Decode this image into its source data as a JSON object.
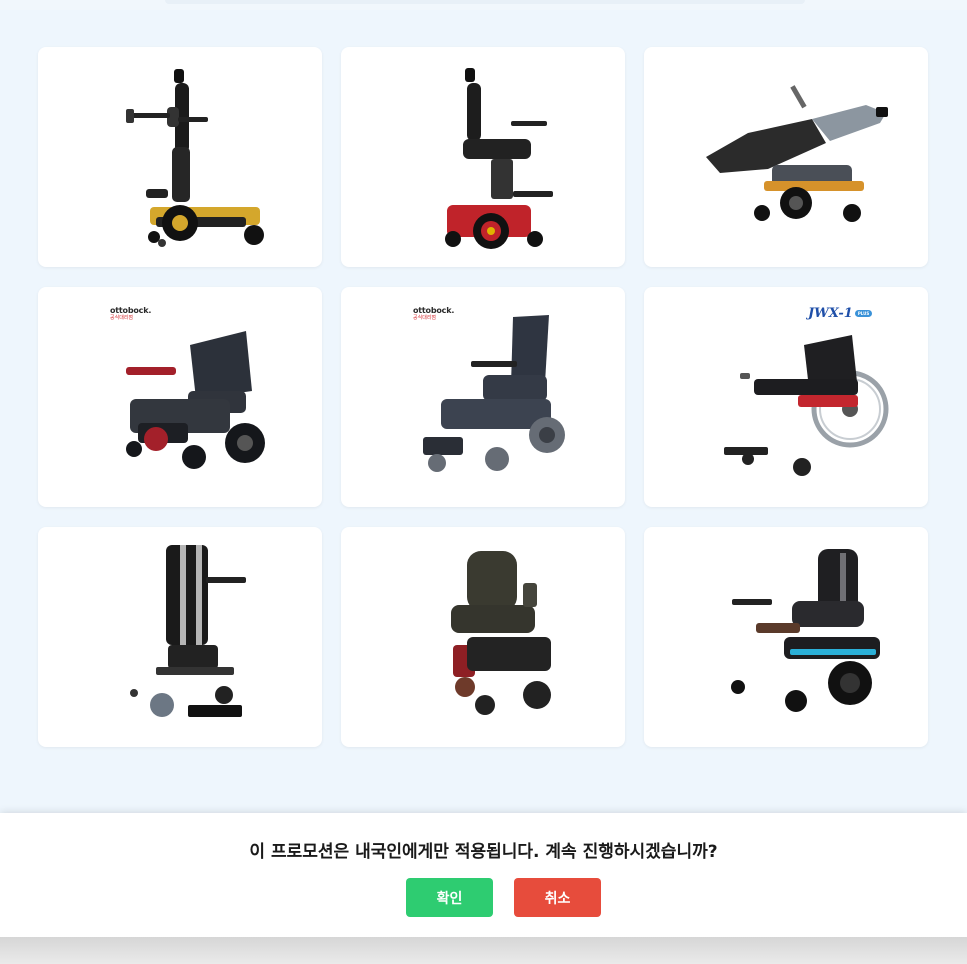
{
  "products": [
    {
      "name": "standing-power-wheelchair-yellow"
    },
    {
      "name": "power-wheelchair-red-frame"
    },
    {
      "name": "reclining-power-wheelchair"
    },
    {
      "name": "ottobock-power-wheelchair",
      "brand": "ottobock.",
      "brand_sub": "공식대리점"
    },
    {
      "name": "ottobock-compact-power-wheelchair",
      "brand": "ottobock.",
      "brand_sub": "공식대리점"
    },
    {
      "name": "jwx1-wheelchair",
      "brand": "JWX-1",
      "brand_badge": "PLUS"
    },
    {
      "name": "standing-wheelchair-stripes"
    },
    {
      "name": "power-wheelchair-captain-seat"
    },
    {
      "name": "sport-power-wheelchair-blue"
    }
  ],
  "dialog": {
    "message": "이 프로모션은 내국인에게만 적용됩니다. 계속 진행하시겠습니까?",
    "confirm_label": "확인",
    "cancel_label": "취소"
  },
  "colors": {
    "confirm": "#2ecc71",
    "cancel": "#e74c3c",
    "page_background": "#eef6fd"
  }
}
